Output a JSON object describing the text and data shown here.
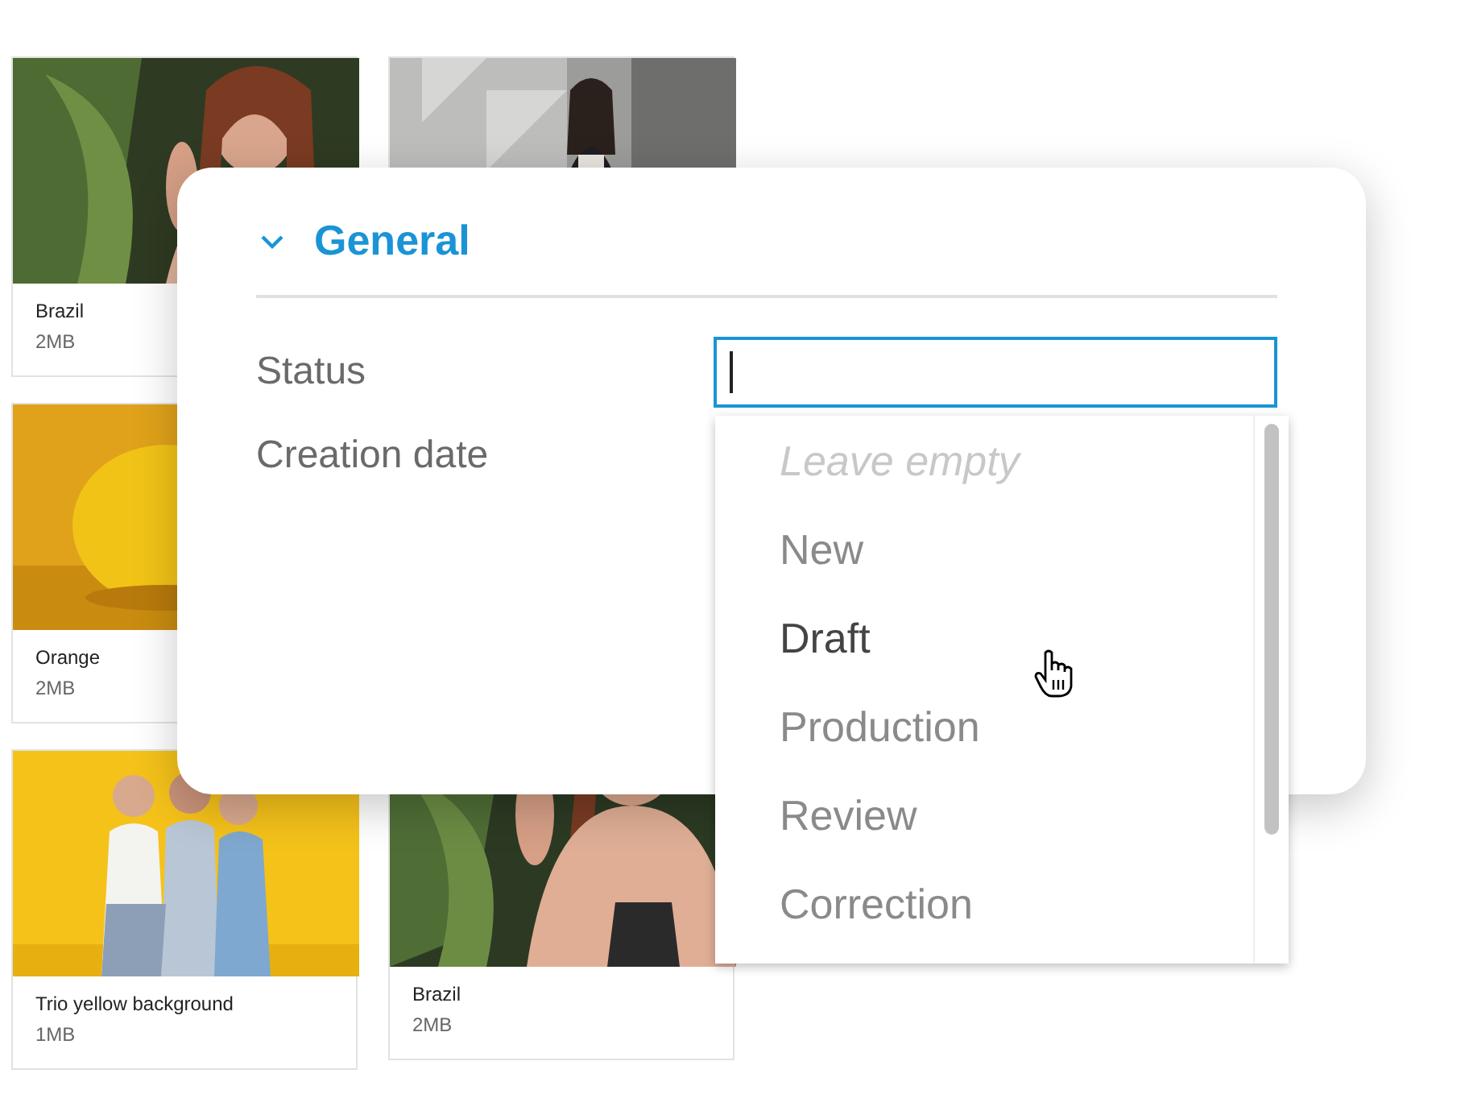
{
  "gallery": {
    "columns": [
      {
        "cards": [
          {
            "kind": "picture",
            "title": "Brazil",
            "size": "2MB"
          },
          {
            "kind": "picture",
            "title": "Orange",
            "size": "2MB"
          },
          {
            "kind": "picture",
            "title": "Trio yellow background",
            "size": "1MB"
          }
        ]
      },
      {
        "cards": [
          {
            "kind": "picture"
          },
          {
            "kind": "picture",
            "title": "Brazil",
            "size": "2MB"
          }
        ]
      }
    ]
  },
  "panel": {
    "section": {
      "title": "General",
      "expanded": true
    },
    "fields": [
      {
        "label": "Status",
        "kind": "dropdown",
        "focused": true
      },
      {
        "label": "Creation date",
        "kind": "plain"
      }
    ],
    "dropdown": {
      "options": [
        {
          "label": "Leave empty",
          "kind": "placeholder",
          "hovered": false
        },
        {
          "label": "New",
          "kind": "option",
          "hovered": false
        },
        {
          "label": "Draft",
          "kind": "option",
          "hovered": true
        },
        {
          "label": "Production",
          "kind": "option",
          "hovered": false
        },
        {
          "label": "Review",
          "kind": "option",
          "hovered": false
        },
        {
          "label": "Correction",
          "kind": "option",
          "hovered": false
        }
      ]
    }
  }
}
